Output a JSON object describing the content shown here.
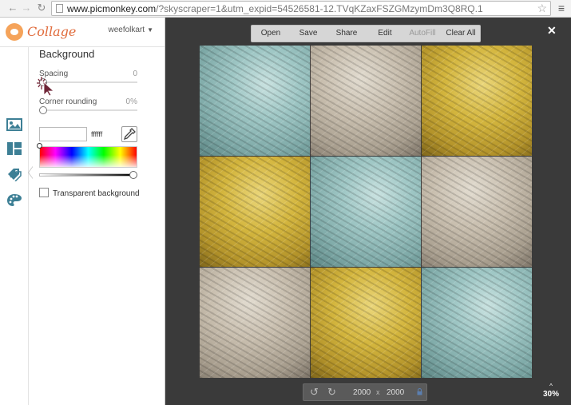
{
  "browser": {
    "url_host": "www.picmonkey.com",
    "url_rest": "/?skyscraper=1&utm_expid=54526581-12.TVqKZaxFSZGMzymDm3Q8RQ.1"
  },
  "app": {
    "logo_text": "Collage",
    "username": "weefolkart"
  },
  "panel": {
    "title": "Background",
    "spacing_label": "Spacing",
    "spacing_value": "0",
    "spacing_level": 0,
    "corner_label": "Corner rounding",
    "corner_value": "0%",
    "corner_level": 0,
    "hex_value": "ffffff",
    "transparent_label": "Transparent background"
  },
  "toolbar": {
    "open": "Open",
    "save": "Save",
    "share": "Share",
    "edit": "Edit",
    "autofill": "AutoFill",
    "clear_all": "Clear All"
  },
  "collage": {
    "cells": [
      "teal",
      "beige",
      "mustard",
      "mustard",
      "teal",
      "beige",
      "beige",
      "mustard",
      "teal"
    ]
  },
  "canvas": {
    "width": "2000",
    "times": "x",
    "height": "2000"
  },
  "zoom": {
    "arrow": "^",
    "value": "30%"
  },
  "colors": {
    "accent": "#e06a3a",
    "workspace": "#3a3a3a"
  }
}
